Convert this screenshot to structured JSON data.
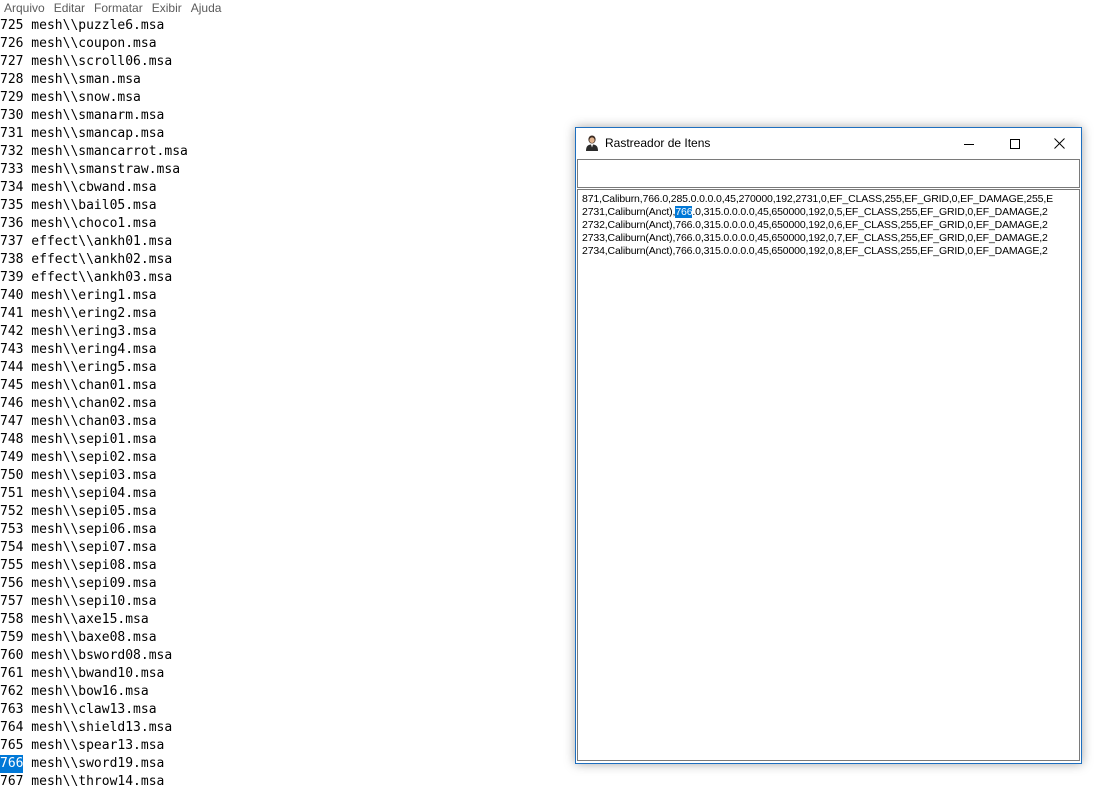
{
  "notepad": {
    "menu": [
      "Arquivo",
      "Editar",
      "Formatar",
      "Exibir",
      "Ajuda"
    ],
    "lines": [
      {
        "num": "725",
        "text": " mesh\\\\puzzle6.msa"
      },
      {
        "num": "726",
        "text": " mesh\\\\coupon.msa"
      },
      {
        "num": "727",
        "text": " mesh\\\\scroll06.msa"
      },
      {
        "num": "728",
        "text": " mesh\\\\sman.msa"
      },
      {
        "num": "729",
        "text": " mesh\\\\snow.msa"
      },
      {
        "num": "730",
        "text": " mesh\\\\smanarm.msa"
      },
      {
        "num": "731",
        "text": " mesh\\\\smancap.msa"
      },
      {
        "num": "732",
        "text": " mesh\\\\smancarrot.msa"
      },
      {
        "num": "733",
        "text": " mesh\\\\smanstraw.msa"
      },
      {
        "num": "734",
        "text": " mesh\\\\cbwand.msa"
      },
      {
        "num": "735",
        "text": " mesh\\\\bail05.msa"
      },
      {
        "num": "736",
        "text": " mesh\\\\choco1.msa"
      },
      {
        "num": "737",
        "text": " effect\\\\ankh01.msa"
      },
      {
        "num": "738",
        "text": " effect\\\\ankh02.msa"
      },
      {
        "num": "739",
        "text": " effect\\\\ankh03.msa"
      },
      {
        "num": "740",
        "text": " mesh\\\\ering1.msa"
      },
      {
        "num": "741",
        "text": " mesh\\\\ering2.msa"
      },
      {
        "num": "742",
        "text": " mesh\\\\ering3.msa"
      },
      {
        "num": "743",
        "text": " mesh\\\\ering4.msa"
      },
      {
        "num": "744",
        "text": " mesh\\\\ering5.msa"
      },
      {
        "num": "745",
        "text": " mesh\\\\chan01.msa"
      },
      {
        "num": "746",
        "text": " mesh\\\\chan02.msa"
      },
      {
        "num": "747",
        "text": " mesh\\\\chan03.msa"
      },
      {
        "num": "748",
        "text": " mesh\\\\sepi01.msa"
      },
      {
        "num": "749",
        "text": " mesh\\\\sepi02.msa"
      },
      {
        "num": "750",
        "text": " mesh\\\\sepi03.msa"
      },
      {
        "num": "751",
        "text": " mesh\\\\sepi04.msa"
      },
      {
        "num": "752",
        "text": " mesh\\\\sepi05.msa"
      },
      {
        "num": "753",
        "text": " mesh\\\\sepi06.msa"
      },
      {
        "num": "754",
        "text": " mesh\\\\sepi07.msa"
      },
      {
        "num": "755",
        "text": " mesh\\\\sepi08.msa"
      },
      {
        "num": "756",
        "text": " mesh\\\\sepi09.msa"
      },
      {
        "num": "757",
        "text": " mesh\\\\sepi10.msa"
      },
      {
        "num": "758",
        "text": " mesh\\\\axe15.msa"
      },
      {
        "num": "759",
        "text": " mesh\\\\baxe08.msa"
      },
      {
        "num": "760",
        "text": " mesh\\\\bsword08.msa"
      },
      {
        "num": "761",
        "text": " mesh\\\\bwand10.msa"
      },
      {
        "num": "762",
        "text": " mesh\\\\bow16.msa"
      },
      {
        "num": "763",
        "text": " mesh\\\\claw13.msa"
      },
      {
        "num": "764",
        "text": " mesh\\\\shield13.msa"
      },
      {
        "num": "765",
        "text": " mesh\\\\spear13.msa"
      },
      {
        "num": "766",
        "text": " mesh\\\\sword19.msa",
        "selected": true
      },
      {
        "num": "767",
        "text": " mesh\\\\throw14.msa"
      }
    ]
  },
  "tracker": {
    "title": "Rastreador de Itens",
    "search_value": "",
    "results": [
      {
        "before": "871,Caliburn,766.0,285.0.0.0.0,45,270000,192,2731,0,EF_CLASS,255,EF_GRID,0,EF_DAMAGE,255,E",
        "highlight": "",
        "after": ""
      },
      {
        "before": "2731,Caliburn(Anct),",
        "highlight": "766",
        "after": ".0,315.0.0.0.0,45,650000,192,0,5,EF_CLASS,255,EF_GRID,0,EF_DAMAGE,2"
      },
      {
        "before": "2732,Caliburn(Anct),766.0,315.0.0.0.0,45,650000,192,0,6,EF_CLASS,255,EF_GRID,0,EF_DAMAGE,2",
        "highlight": "",
        "after": ""
      },
      {
        "before": "2733,Caliburn(Anct),766.0,315.0.0.0.0,45,650000,192,0,7,EF_CLASS,255,EF_GRID,0,EF_DAMAGE,2",
        "highlight": "",
        "after": ""
      },
      {
        "before": "2734,Caliburn(Anct),766.0,315.0.0.0.0,45,650000,192,0,8,EF_CLASS,255,EF_GRID,0,EF_DAMAGE,2",
        "highlight": "",
        "after": ""
      }
    ]
  },
  "colors": {
    "selection": "#0078d7",
    "window_border": "#1e6fbf"
  },
  "icons": {
    "app": "user-icon",
    "minimize": "minimize-icon",
    "maximize": "maximize-icon",
    "close": "close-icon"
  }
}
